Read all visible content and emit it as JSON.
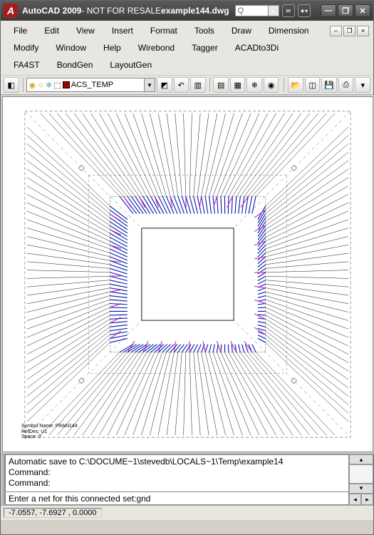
{
  "titlebar": {
    "app": "AutoCAD 2009",
    "notice": " - NOT FOR RESALE ",
    "file": "example144.dwg",
    "search_q": "Q",
    "help_star": "★▾",
    "btn_min": "—",
    "btn_max": "❐",
    "btn_close": "✕"
  },
  "menu": {
    "row1": [
      "File",
      "Edit",
      "View",
      "Insert",
      "Format",
      "Tools",
      "Draw",
      "Dimension"
    ],
    "row2": [
      "Modify",
      "Window",
      "Help",
      "Wirebond",
      "Tagger",
      "ACADto3Di"
    ],
    "row3": [
      "FA4ST",
      "BondGen",
      "LayoutGen"
    ],
    "doc_min": "–",
    "doc_max": "❐",
    "doc_close": "×"
  },
  "layer": {
    "current_name": "ACS_TEMP",
    "dropdown_arrow": "▼"
  },
  "icons": {
    "qnew": "◫",
    "bulb": "◉",
    "sun": "☼",
    "freeze": "❄",
    "lock": "⬚",
    "layer_mgr": "◧",
    "match": "◩",
    "prev": "↶",
    "open": "📂",
    "save": "💾",
    "print": "⎙",
    "more": "▾"
  },
  "drawing": {
    "label1": "Symbol Name: FRAN144",
    "label2": "RefDes: U1",
    "label3": "Space: 0"
  },
  "command": {
    "history_line1": "Automatic save to C:\\DOCUME~1\\stevedb\\LOCALS~1\\Temp\\example14",
    "history_line2": "Command:",
    "history_line3": "Command:",
    "prompt": "Enter a net for this connected set: ",
    "input_value": "gnd",
    "scroll_up": "▴",
    "scroll_dn": "▾",
    "scroll_l": "◂",
    "scroll_r": "▸"
  },
  "status": {
    "coords": "-7.0557, -7.6927 , 0.0000"
  }
}
